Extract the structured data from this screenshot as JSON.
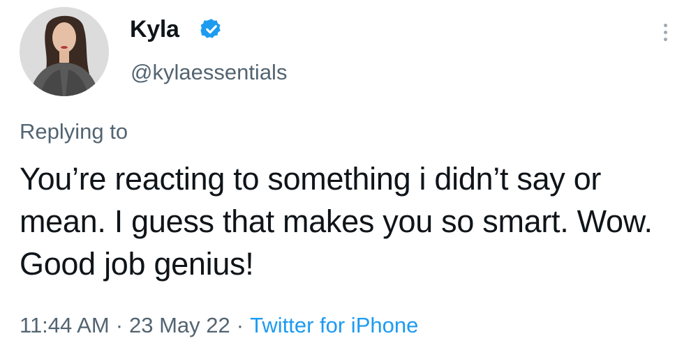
{
  "tweet": {
    "author": {
      "display_name": "Kyla",
      "handle": "@kylaessentials",
      "verified": true,
      "verified_icon": "verified-badge-icon",
      "avatar_icon": "profile-photo"
    },
    "more_icon": "more-vertical-icon",
    "replying_to_label": "Replying to",
    "text": "You’re reacting to something i didn’t say or mean. I guess that makes you so smart. Wow. Good job genius!",
    "time": "11:44 AM",
    "date": "23 May 22",
    "separator": "·",
    "source": "Twitter for iPhone"
  },
  "colors": {
    "text_primary": "#0f1419",
    "text_secondary": "#536471",
    "accent": "#1d9bf0",
    "background": "#ffffff"
  }
}
